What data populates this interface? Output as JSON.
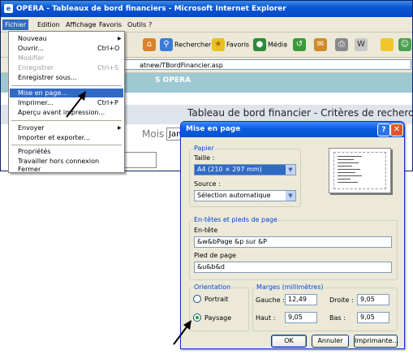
{
  "browser": {
    "title": "OPERA - Tableaux de bord financiers - Microsoft Internet Explorer",
    "menus": [
      "Fichier",
      "Edition",
      "Affichage",
      "Favoris",
      "Outils",
      "?"
    ],
    "toolbar": {
      "search_label": "Rechercher",
      "favorites_label": "Favoris",
      "media_label": "Média"
    },
    "address_url": "atnew/TBordFinancier.asp"
  },
  "page": {
    "banner_text": "S OPERA",
    "heading": "Tableau de bord financier - Critères de recherche",
    "month_label": "Mois",
    "month_value": "Jan"
  },
  "file_menu": {
    "items": [
      {
        "label": "Nouveau",
        "shortcut": "",
        "submenu": true,
        "disabled": false,
        "highlighted": false
      },
      {
        "label": "Ouvrir...",
        "shortcut": "Ctrl+O",
        "submenu": false,
        "disabled": false,
        "highlighted": false
      },
      {
        "label": "Modifier",
        "shortcut": "",
        "submenu": false,
        "disabled": true,
        "highlighted": false
      },
      {
        "label": "Enregistrer",
        "shortcut": "Ctrl+S",
        "submenu": false,
        "disabled": true,
        "highlighted": false
      },
      {
        "label": "Enregistrer sous...",
        "shortcut": "",
        "submenu": false,
        "disabled": false,
        "highlighted": false
      },
      {
        "label": "Mise en page...",
        "shortcut": "",
        "submenu": false,
        "disabled": false,
        "highlighted": true
      },
      {
        "label": "Imprimer...",
        "shortcut": "Ctrl+P",
        "submenu": false,
        "disabled": false,
        "highlighted": false
      },
      {
        "label": "Aperçu avant impression...",
        "shortcut": "",
        "submenu": false,
        "disabled": false,
        "highlighted": false
      },
      {
        "label": "Envoyer",
        "shortcut": "",
        "submenu": true,
        "disabled": false,
        "highlighted": false
      },
      {
        "label": "Importer et exporter...",
        "shortcut": "",
        "submenu": false,
        "disabled": false,
        "highlighted": false
      },
      {
        "label": "Propriétés",
        "shortcut": "",
        "submenu": false,
        "disabled": false,
        "highlighted": false
      },
      {
        "label": "Travailler hors connexion",
        "shortcut": "",
        "submenu": false,
        "disabled": false,
        "highlighted": false
      },
      {
        "label": "Fermer",
        "shortcut": "",
        "submenu": false,
        "disabled": false,
        "highlighted": false
      }
    ]
  },
  "dialog": {
    "title": "Mise en page",
    "help_label": "?",
    "close_label": "✕",
    "paper": {
      "group_title": "Papier",
      "size_label": "Taille :",
      "size_value": "A4 (210 × 297 mm)",
      "source_label": "Source :",
      "source_value": "Sélection automatique"
    },
    "headers": {
      "group_title": "En-têtes et pieds de page",
      "header_label": "En-tête",
      "header_value": "&w&bPage &p sur &P",
      "footer_label": "Pied de page",
      "footer_value": "&u&b&d"
    },
    "orientation": {
      "group_title": "Orientation",
      "portrait_label": "Portrait",
      "landscape_label": "Paysage",
      "selected": "Paysage"
    },
    "margins": {
      "group_title": "Marges (millimètres)",
      "left_label": "Gauche :",
      "left_value": "12,49",
      "right_label": "Droite :",
      "right_value": "9,05",
      "top_label": "Haut :",
      "top_value": "9,05",
      "bottom_label": "Bas :",
      "bottom_value": "9,05"
    },
    "buttons": {
      "ok": "OK",
      "cancel": "Annuler",
      "printer": "Imprimante..."
    }
  },
  "colors": {
    "titlebar": "#0a57d6",
    "menu_highlight": "#316ac5",
    "dialog_face": "#ece9d8",
    "group_title": "#0046d5"
  }
}
